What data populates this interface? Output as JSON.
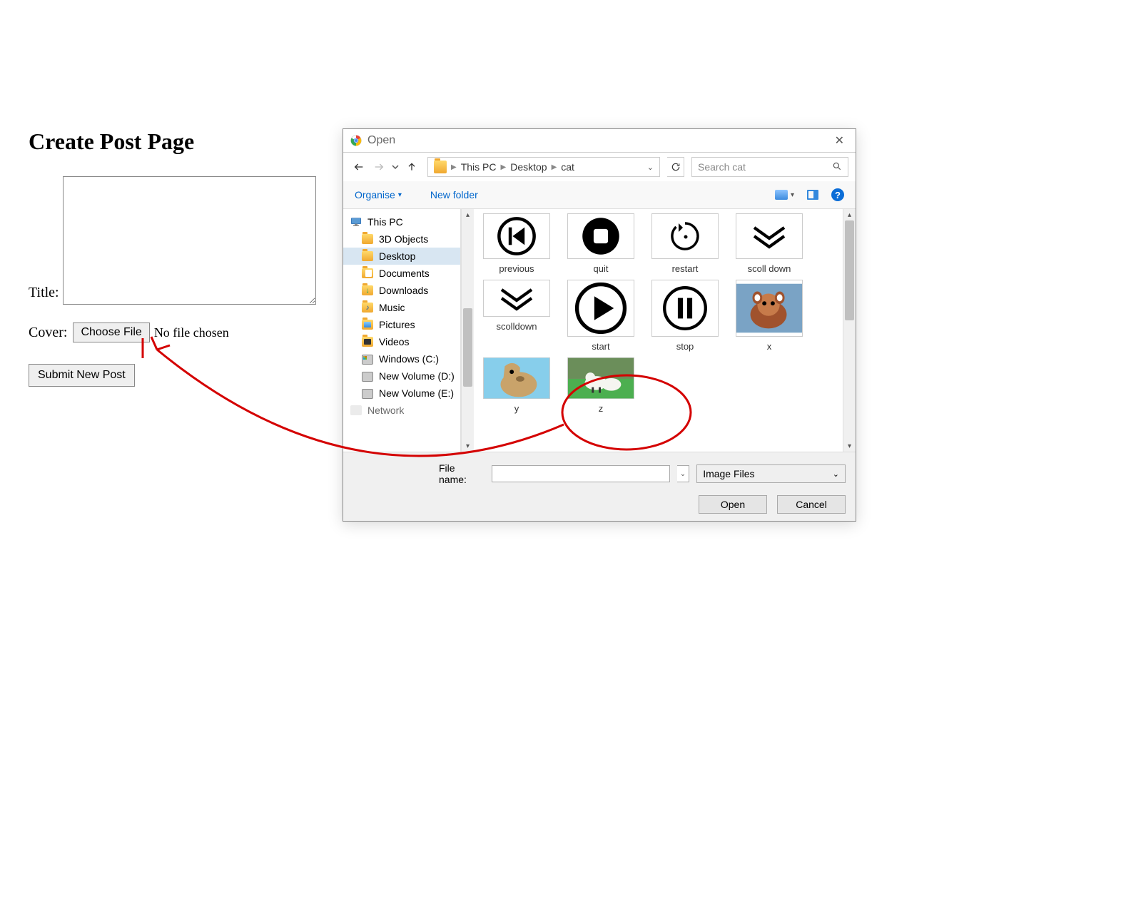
{
  "page": {
    "heading": "Create Post Page",
    "title_label": "Title:",
    "cover_label": "Cover:",
    "choose_file": "Choose File",
    "no_file": "No file chosen",
    "submit": "Submit New Post"
  },
  "dialog": {
    "title": "Open",
    "breadcrumb": [
      "This PC",
      "Desktop",
      "cat"
    ],
    "search_placeholder": "Search cat",
    "toolbar": {
      "organise": "Organise",
      "new_folder": "New folder"
    },
    "tree": {
      "this_pc": "This PC",
      "objects3d": "3D Objects",
      "desktop": "Desktop",
      "documents": "Documents",
      "downloads": "Downloads",
      "music": "Music",
      "pictures": "Pictures",
      "videos": "Videos",
      "windows_c": "Windows (C:)",
      "volume_d": "New Volume (D:)",
      "volume_e": "New Volume (E:)",
      "network": "Network"
    },
    "thumbs": {
      "previous": "previous",
      "quit": "quit",
      "restart": "restart",
      "scoll_down": "scoll down",
      "scolldown": "scolldown",
      "start": "start",
      "stop": "stop",
      "x": "x",
      "y": "y",
      "z": "z"
    },
    "footer": {
      "file_name_label": "File name:",
      "filter": "Image Files",
      "open": "Open",
      "cancel": "Cancel"
    }
  }
}
